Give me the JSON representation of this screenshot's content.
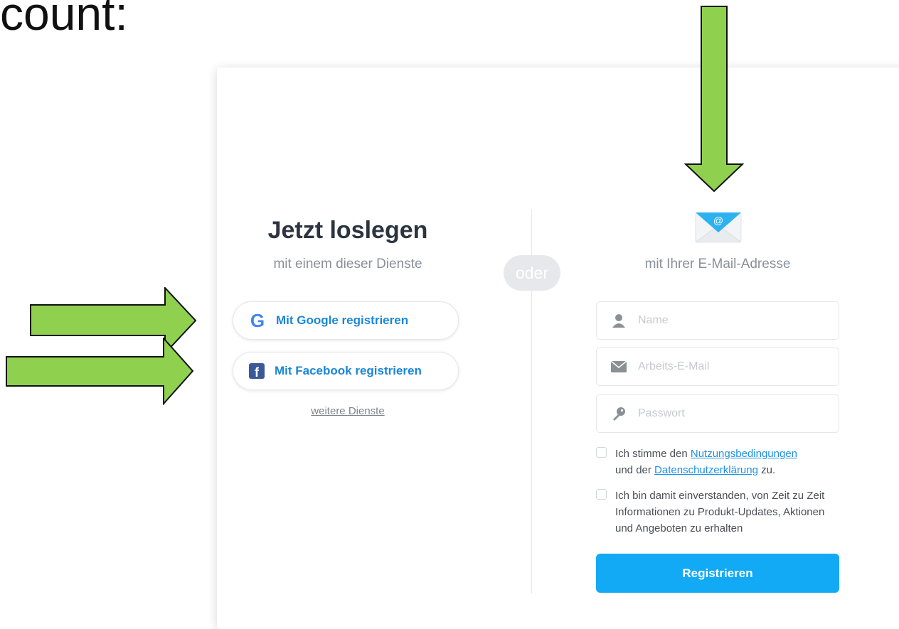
{
  "slide": {
    "text_fragment": "count:"
  },
  "left_panel": {
    "heading": "Jetzt loslegen",
    "subheading": "mit einem dieser Dienste",
    "google_button": "Mit Google registrieren",
    "facebook_button": "Mit Facebook registrieren",
    "more_services": "weitere Dienste",
    "facebook_icon_letter": "f",
    "google_icon_letter": "G"
  },
  "separator": {
    "label": "oder"
  },
  "right_panel": {
    "email_heading": "mit Ihrer E-Mail-Adresse",
    "fields": {
      "name_placeholder": "Name",
      "email_placeholder": "Arbeits-E-Mail",
      "password_placeholder": "Passwort"
    },
    "terms": {
      "prefix": "Ich stimme den ",
      "terms_link": "Nutzungsbedingungen",
      "middle": "und der ",
      "privacy_link": "Datenschutzerklärung",
      "suffix": " zu."
    },
    "marketing_consent": "Ich bin damit einverstanden, von Zeit zu Zeit Informationen zu Produkt-Updates, Aktionen und Angeboten zu erhalten",
    "submit_button": "Registrieren"
  },
  "colors": {
    "annotation_arrow": "#8fd14f",
    "primary_button": "#12aaf5",
    "link": "#1e90e8",
    "facebook": "#3b5998"
  },
  "icons": {
    "email": "envelope-icon",
    "name": "user-icon",
    "work_email": "mail-icon",
    "password": "key-icon"
  }
}
